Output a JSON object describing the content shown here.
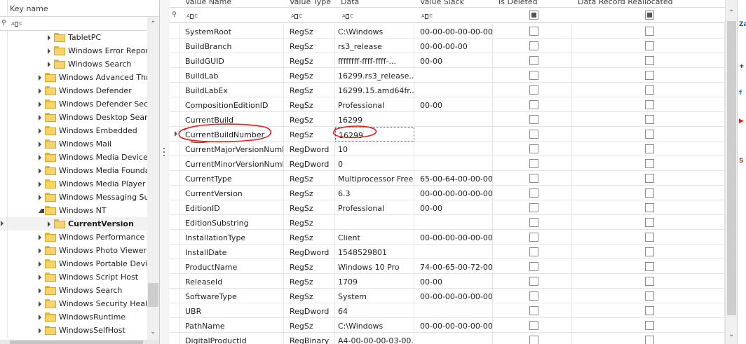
{
  "left_panel": {
    "column_title": "Key name",
    "filter_icon": "filter-pin-icon",
    "tree": [
      {
        "label": "TabletPC",
        "level": 3,
        "expanded": false,
        "selected": false
      },
      {
        "label": "Windows Error Reportin",
        "level": 3,
        "expanded": false,
        "selected": false
      },
      {
        "label": "Windows Search",
        "level": 3,
        "expanded": false,
        "selected": false
      },
      {
        "label": "Windows Advanced Threa",
        "level": 2,
        "expanded": false,
        "selected": false
      },
      {
        "label": "Windows Defender",
        "level": 2,
        "expanded": false,
        "selected": false
      },
      {
        "label": "Windows Defender Securi",
        "level": 2,
        "expanded": false,
        "selected": false
      },
      {
        "label": "Windows Desktop Search",
        "level": 2,
        "expanded": false,
        "selected": false
      },
      {
        "label": "Windows Embedded",
        "level": 2,
        "expanded": false,
        "selected": false
      },
      {
        "label": "Windows Mail",
        "level": 2,
        "expanded": false,
        "selected": false
      },
      {
        "label": "Windows Media Device Ma",
        "level": 2,
        "expanded": false,
        "selected": false
      },
      {
        "label": "Windows Media Foundatio",
        "level": 2,
        "expanded": false,
        "selected": false
      },
      {
        "label": "Windows Media Player NSS",
        "level": 2,
        "expanded": false,
        "selected": false
      },
      {
        "label": "Windows Messaging Subsy",
        "level": 2,
        "expanded": false,
        "selected": false
      },
      {
        "label": "Windows NT",
        "level": 2,
        "expanded": true,
        "selected": false
      },
      {
        "label": "CurrentVersion",
        "level": 3,
        "expanded": false,
        "selected": true
      },
      {
        "label": "Windows Performance Too",
        "level": 2,
        "expanded": false,
        "selected": false
      },
      {
        "label": "Windows Photo Viewer",
        "level": 2,
        "expanded": false,
        "selected": false
      },
      {
        "label": "Windows Portable Devices",
        "level": 2,
        "expanded": false,
        "selected": false
      },
      {
        "label": "Windows Script Host",
        "level": 2,
        "expanded": false,
        "selected": false
      },
      {
        "label": "Windows Search",
        "level": 2,
        "expanded": false,
        "selected": false
      },
      {
        "label": "Windows Security Health",
        "level": 2,
        "expanded": false,
        "selected": false
      },
      {
        "label": "WindowsRuntime",
        "level": 2,
        "expanded": false,
        "selected": false
      },
      {
        "label": "WindowsSelfHost",
        "level": 2,
        "expanded": false,
        "selected": false
      }
    ]
  },
  "grid": {
    "columns": [
      "Value Name",
      "Value Type",
      "Data",
      "Value Slack",
      "Is Deleted",
      "Data Record Reallocated"
    ],
    "rows": [
      {
        "name": "SystemRoot",
        "type": "RegSz",
        "data": "C:\\Windows",
        "slack": "00-00-00-00-00-00",
        "current": false
      },
      {
        "name": "BuildBranch",
        "type": "RegSz",
        "data": "rs3_release",
        "slack": "00-00-00-00",
        "current": false
      },
      {
        "name": "BuildGUID",
        "type": "RegSz",
        "data": "ffffffff-ffff-ffff-...",
        "slack": "00-00",
        "current": false
      },
      {
        "name": "BuildLab",
        "type": "RegSz",
        "data": "16299.rs3_release....",
        "slack": "",
        "current": false
      },
      {
        "name": "BuildLabEx",
        "type": "RegSz",
        "data": "16299.15.amd64fr...",
        "slack": "",
        "current": false
      },
      {
        "name": "CompositionEditionID",
        "type": "RegSz",
        "data": "Professional",
        "slack": "00-00",
        "current": false
      },
      {
        "name": "CurrentBuild",
        "type": "RegSz",
        "data": "16299",
        "slack": "",
        "current": false
      },
      {
        "name": "CurrentBuildNumber",
        "type": "RegSz",
        "data": "16299",
        "slack": "",
        "current": true
      },
      {
        "name": "CurrentMajorVersionNumber",
        "type": "RegDword",
        "data": "10",
        "slack": "",
        "current": false
      },
      {
        "name": "CurrentMinorVersionNumber",
        "type": "RegDword",
        "data": "0",
        "slack": "",
        "current": false
      },
      {
        "name": "CurrentType",
        "type": "RegSz",
        "data": "Multiprocessor Free",
        "slack": "65-00-64-00-00-00-...",
        "current": false
      },
      {
        "name": "CurrentVersion",
        "type": "RegSz",
        "data": "6.3",
        "slack": "00-00-00-00-00-00",
        "current": false
      },
      {
        "name": "EditionID",
        "type": "RegSz",
        "data": "Professional",
        "slack": "00-00",
        "current": false
      },
      {
        "name": "EditionSubstring",
        "type": "RegSz",
        "data": "",
        "slack": "",
        "current": false
      },
      {
        "name": "InstallationType",
        "type": "RegSz",
        "data": "Client",
        "slack": "00-00-00-00-00-00",
        "current": false
      },
      {
        "name": "InstallDate",
        "type": "RegDword",
        "data": "1548529801",
        "slack": "",
        "current": false
      },
      {
        "name": "ProductName",
        "type": "RegSz",
        "data": "Windows 10 Pro",
        "slack": "74-00-65-00-72-00-...",
        "current": false
      },
      {
        "name": "ReleaseId",
        "type": "RegSz",
        "data": "1709",
        "slack": "00-00",
        "current": false
      },
      {
        "name": "SoftwareType",
        "type": "RegSz",
        "data": "System",
        "slack": "00-00-00-00-00-00",
        "current": false
      },
      {
        "name": "UBR",
        "type": "RegDword",
        "data": "64",
        "slack": "",
        "current": false
      },
      {
        "name": "PathName",
        "type": "RegSz",
        "data": "C:\\Windows",
        "slack": "00-00-00-00-00-00",
        "current": false
      },
      {
        "name": "DigitalProductId",
        "type": "RegBinary",
        "data": "A4-00-00-00-03-00...",
        "slack": "",
        "current": false
      }
    ]
  },
  "edge_strip": {
    "items": [
      {
        "text": "Za",
        "color": "#1a5fb4"
      },
      {
        "text": "+",
        "color": "#222222"
      },
      {
        "text": "f",
        "color": "#1877f2"
      },
      {
        "text": "▶",
        "color": "#e62117"
      },
      {
        "text": "S",
        "color": "#c0392b"
      }
    ]
  },
  "colors": {
    "folder": "#f6d46a",
    "annotation": "#e02020",
    "selection": "#f2f2f2"
  }
}
